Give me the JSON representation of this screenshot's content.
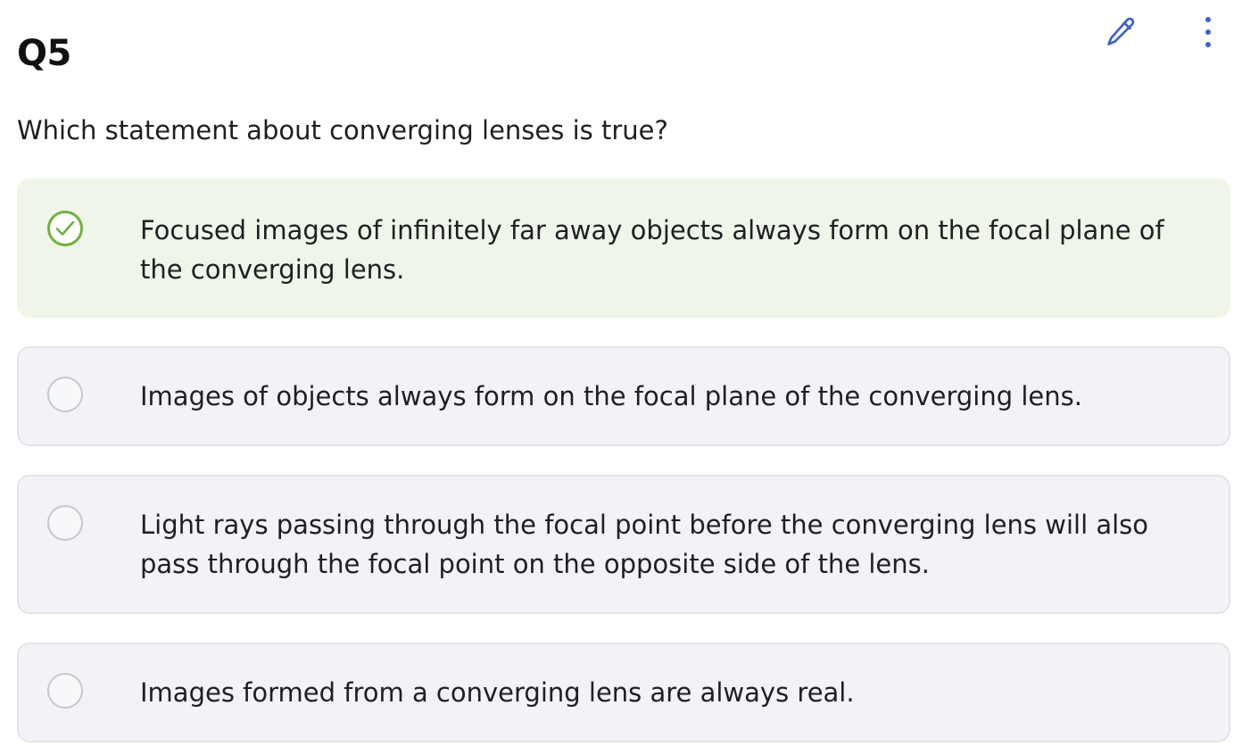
{
  "question": {
    "number": "Q5",
    "text": "Which statement about converging lenses is true?"
  },
  "toolbar": {
    "edit_icon": "pencil-icon",
    "more_icon": "more-vertical-icon"
  },
  "options": [
    {
      "text": "Focused images of infinitely far away objects always form on the focal plane of the converging lens.",
      "correct": true,
      "marker_icon": "check-circle-icon"
    },
    {
      "text": "Images of objects always form on the focal plane of the converging lens.",
      "correct": false,
      "marker_icon": "empty-circle-icon"
    },
    {
      "text": "Light rays passing through the focal point before the converging lens will also pass through the focal point on the opposite side of the lens.",
      "correct": false,
      "marker_icon": "empty-circle-icon"
    },
    {
      "text": "Images formed from a converging lens are always real.",
      "correct": false,
      "marker_icon": "empty-circle-icon"
    }
  ],
  "colors": {
    "accent_blue": "#3d63c8",
    "correct_green": "#6fb23a",
    "correct_background": "#eff5e8",
    "option_background": "#f2f3f7"
  }
}
